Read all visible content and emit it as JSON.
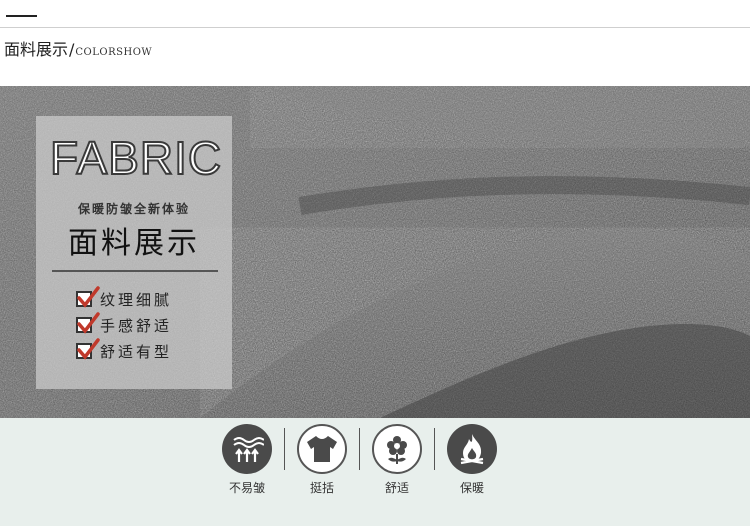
{
  "header": {
    "title_cn": "面料展示",
    "separator": "/",
    "title_en": "COLORSHOW"
  },
  "panel": {
    "fabric_word": "FABRIC",
    "tagline": "保暖防皱全新体验",
    "heading": "面料展示",
    "features": [
      "纹理细腻",
      "手感舒适",
      "舒适有型"
    ]
  },
  "properties": [
    {
      "label": "不易皱",
      "icon": "wrinkle-free-icon"
    },
    {
      "label": "挺括",
      "icon": "tshirt-icon"
    },
    {
      "label": "舒适",
      "icon": "flower-icon"
    },
    {
      "label": "保暖",
      "icon": "flame-icon"
    }
  ],
  "colors": {
    "fabric_gray": "#5a5a5a",
    "check_red": "#c0392b",
    "band_bg": "#e8efec",
    "icon_dark": "#4a4a4a"
  }
}
